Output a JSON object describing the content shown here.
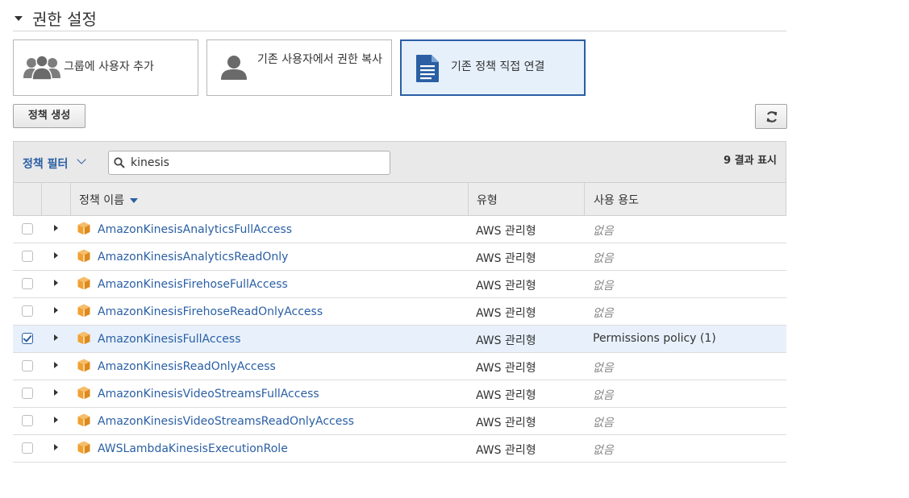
{
  "section": {
    "title": "권한 설정"
  },
  "tiles": [
    {
      "label": "그룹에 사용자 추가",
      "icon": "users-group-icon"
    },
    {
      "label": "기존 사용자에서 권한 복사",
      "icon": "user-icon"
    },
    {
      "label": "기존 정책 직접 연결",
      "icon": "document-icon",
      "selected": true
    }
  ],
  "toolbar": {
    "create_label": "정책 생성",
    "refresh_icon": "refresh-icon"
  },
  "filter": {
    "label": "정책 필터",
    "search_value": "kinesis",
    "result_text": "9 결과 표시"
  },
  "columns": {
    "name": "정책 이름",
    "type": "유형",
    "usage": "사용 용도"
  },
  "rows": [
    {
      "name": "AmazonKinesisAnalyticsFullAccess",
      "type": "AWS 관리형",
      "usage": "없음",
      "checked": false
    },
    {
      "name": "AmazonKinesisAnalyticsReadOnly",
      "type": "AWS 관리형",
      "usage": "없음",
      "checked": false
    },
    {
      "name": "AmazonKinesisFirehoseFullAccess",
      "type": "AWS 관리형",
      "usage": "없음",
      "checked": false
    },
    {
      "name": "AmazonKinesisFirehoseReadOnlyAccess",
      "type": "AWS 관리형",
      "usage": "없음",
      "checked": false
    },
    {
      "name": "AmazonKinesisFullAccess",
      "type": "AWS 관리형",
      "usage": "Permissions policy (1)",
      "checked": true
    },
    {
      "name": "AmazonKinesisReadOnlyAccess",
      "type": "AWS 관리형",
      "usage": "없음",
      "checked": false
    },
    {
      "name": "AmazonKinesisVideoStreamsFullAccess",
      "type": "AWS 관리형",
      "usage": "없음",
      "checked": false
    },
    {
      "name": "AmazonKinesisVideoStreamsReadOnlyAccess",
      "type": "AWS 관리형",
      "usage": "없음",
      "checked": false
    },
    {
      "name": "AWSLambdaKinesisExecutionRole",
      "type": "AWS 관리형",
      "usage": "없음",
      "checked": false
    }
  ],
  "colors": {
    "accent": "#2a5fa4",
    "policy_icon": "#f0a030",
    "selected_row": "#e8f1fb"
  }
}
